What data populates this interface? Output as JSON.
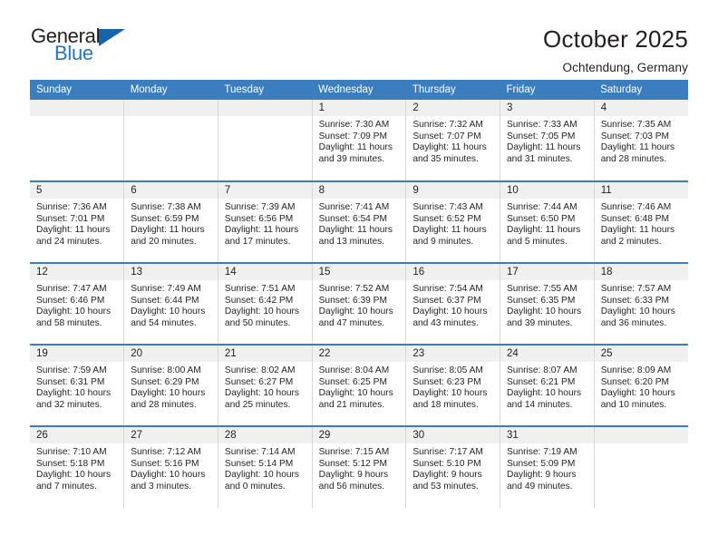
{
  "logo": {
    "text_top": "General",
    "text_bottom": "Blue",
    "triangle_color": "#1565a8",
    "blue_color": "#2077bd"
  },
  "header": {
    "title": "October 2025",
    "subtitle": "Ochtendung, Germany"
  },
  "theme": {
    "header_bar": "#3a7ebf",
    "daynum_band": "#f0f0f0",
    "text": "#231f20",
    "cell_border": "#d8d8d8"
  },
  "weekday_headers": [
    "Sunday",
    "Monday",
    "Tuesday",
    "Wednesday",
    "Thursday",
    "Friday",
    "Saturday"
  ],
  "weeks": [
    [
      {
        "day": "",
        "sunrise": "",
        "sunset": "",
        "daylight_line1": "",
        "daylight_line2": ""
      },
      {
        "day": "",
        "sunrise": "",
        "sunset": "",
        "daylight_line1": "",
        "daylight_line2": ""
      },
      {
        "day": "",
        "sunrise": "",
        "sunset": "",
        "daylight_line1": "",
        "daylight_line2": ""
      },
      {
        "day": "1",
        "sunrise": "Sunrise: 7:30 AM",
        "sunset": "Sunset: 7:09 PM",
        "daylight_line1": "Daylight: 11 hours",
        "daylight_line2": "and 39 minutes."
      },
      {
        "day": "2",
        "sunrise": "Sunrise: 7:32 AM",
        "sunset": "Sunset: 7:07 PM",
        "daylight_line1": "Daylight: 11 hours",
        "daylight_line2": "and 35 minutes."
      },
      {
        "day": "3",
        "sunrise": "Sunrise: 7:33 AM",
        "sunset": "Sunset: 7:05 PM",
        "daylight_line1": "Daylight: 11 hours",
        "daylight_line2": "and 31 minutes."
      },
      {
        "day": "4",
        "sunrise": "Sunrise: 7:35 AM",
        "sunset": "Sunset: 7:03 PM",
        "daylight_line1": "Daylight: 11 hours",
        "daylight_line2": "and 28 minutes."
      }
    ],
    [
      {
        "day": "5",
        "sunrise": "Sunrise: 7:36 AM",
        "sunset": "Sunset: 7:01 PM",
        "daylight_line1": "Daylight: 11 hours",
        "daylight_line2": "and 24 minutes."
      },
      {
        "day": "6",
        "sunrise": "Sunrise: 7:38 AM",
        "sunset": "Sunset: 6:59 PM",
        "daylight_line1": "Daylight: 11 hours",
        "daylight_line2": "and 20 minutes."
      },
      {
        "day": "7",
        "sunrise": "Sunrise: 7:39 AM",
        "sunset": "Sunset: 6:56 PM",
        "daylight_line1": "Daylight: 11 hours",
        "daylight_line2": "and 17 minutes."
      },
      {
        "day": "8",
        "sunrise": "Sunrise: 7:41 AM",
        "sunset": "Sunset: 6:54 PM",
        "daylight_line1": "Daylight: 11 hours",
        "daylight_line2": "and 13 minutes."
      },
      {
        "day": "9",
        "sunrise": "Sunrise: 7:43 AM",
        "sunset": "Sunset: 6:52 PM",
        "daylight_line1": "Daylight: 11 hours",
        "daylight_line2": "and 9 minutes."
      },
      {
        "day": "10",
        "sunrise": "Sunrise: 7:44 AM",
        "sunset": "Sunset: 6:50 PM",
        "daylight_line1": "Daylight: 11 hours",
        "daylight_line2": "and 5 minutes."
      },
      {
        "day": "11",
        "sunrise": "Sunrise: 7:46 AM",
        "sunset": "Sunset: 6:48 PM",
        "daylight_line1": "Daylight: 11 hours",
        "daylight_line2": "and 2 minutes."
      }
    ],
    [
      {
        "day": "12",
        "sunrise": "Sunrise: 7:47 AM",
        "sunset": "Sunset: 6:46 PM",
        "daylight_line1": "Daylight: 10 hours",
        "daylight_line2": "and 58 minutes."
      },
      {
        "day": "13",
        "sunrise": "Sunrise: 7:49 AM",
        "sunset": "Sunset: 6:44 PM",
        "daylight_line1": "Daylight: 10 hours",
        "daylight_line2": "and 54 minutes."
      },
      {
        "day": "14",
        "sunrise": "Sunrise: 7:51 AM",
        "sunset": "Sunset: 6:42 PM",
        "daylight_line1": "Daylight: 10 hours",
        "daylight_line2": "and 50 minutes."
      },
      {
        "day": "15",
        "sunrise": "Sunrise: 7:52 AM",
        "sunset": "Sunset: 6:39 PM",
        "daylight_line1": "Daylight: 10 hours",
        "daylight_line2": "and 47 minutes."
      },
      {
        "day": "16",
        "sunrise": "Sunrise: 7:54 AM",
        "sunset": "Sunset: 6:37 PM",
        "daylight_line1": "Daylight: 10 hours",
        "daylight_line2": "and 43 minutes."
      },
      {
        "day": "17",
        "sunrise": "Sunrise: 7:55 AM",
        "sunset": "Sunset: 6:35 PM",
        "daylight_line1": "Daylight: 10 hours",
        "daylight_line2": "and 39 minutes."
      },
      {
        "day": "18",
        "sunrise": "Sunrise: 7:57 AM",
        "sunset": "Sunset: 6:33 PM",
        "daylight_line1": "Daylight: 10 hours",
        "daylight_line2": "and 36 minutes."
      }
    ],
    [
      {
        "day": "19",
        "sunrise": "Sunrise: 7:59 AM",
        "sunset": "Sunset: 6:31 PM",
        "daylight_line1": "Daylight: 10 hours",
        "daylight_line2": "and 32 minutes."
      },
      {
        "day": "20",
        "sunrise": "Sunrise: 8:00 AM",
        "sunset": "Sunset: 6:29 PM",
        "daylight_line1": "Daylight: 10 hours",
        "daylight_line2": "and 28 minutes."
      },
      {
        "day": "21",
        "sunrise": "Sunrise: 8:02 AM",
        "sunset": "Sunset: 6:27 PM",
        "daylight_line1": "Daylight: 10 hours",
        "daylight_line2": "and 25 minutes."
      },
      {
        "day": "22",
        "sunrise": "Sunrise: 8:04 AM",
        "sunset": "Sunset: 6:25 PM",
        "daylight_line1": "Daylight: 10 hours",
        "daylight_line2": "and 21 minutes."
      },
      {
        "day": "23",
        "sunrise": "Sunrise: 8:05 AM",
        "sunset": "Sunset: 6:23 PM",
        "daylight_line1": "Daylight: 10 hours",
        "daylight_line2": "and 18 minutes."
      },
      {
        "day": "24",
        "sunrise": "Sunrise: 8:07 AM",
        "sunset": "Sunset: 6:21 PM",
        "daylight_line1": "Daylight: 10 hours",
        "daylight_line2": "and 14 minutes."
      },
      {
        "day": "25",
        "sunrise": "Sunrise: 8:09 AM",
        "sunset": "Sunset: 6:20 PM",
        "daylight_line1": "Daylight: 10 hours",
        "daylight_line2": "and 10 minutes."
      }
    ],
    [
      {
        "day": "26",
        "sunrise": "Sunrise: 7:10 AM",
        "sunset": "Sunset: 5:18 PM",
        "daylight_line1": "Daylight: 10 hours",
        "daylight_line2": "and 7 minutes."
      },
      {
        "day": "27",
        "sunrise": "Sunrise: 7:12 AM",
        "sunset": "Sunset: 5:16 PM",
        "daylight_line1": "Daylight: 10 hours",
        "daylight_line2": "and 3 minutes."
      },
      {
        "day": "28",
        "sunrise": "Sunrise: 7:14 AM",
        "sunset": "Sunset: 5:14 PM",
        "daylight_line1": "Daylight: 10 hours",
        "daylight_line2": "and 0 minutes."
      },
      {
        "day": "29",
        "sunrise": "Sunrise: 7:15 AM",
        "sunset": "Sunset: 5:12 PM",
        "daylight_line1": "Daylight: 9 hours",
        "daylight_line2": "and 56 minutes."
      },
      {
        "day": "30",
        "sunrise": "Sunrise: 7:17 AM",
        "sunset": "Sunset: 5:10 PM",
        "daylight_line1": "Daylight: 9 hours",
        "daylight_line2": "and 53 minutes."
      },
      {
        "day": "31",
        "sunrise": "Sunrise: 7:19 AM",
        "sunset": "Sunset: 5:09 PM",
        "daylight_line1": "Daylight: 9 hours",
        "daylight_line2": "and 49 minutes."
      },
      {
        "day": "",
        "sunrise": "",
        "sunset": "",
        "daylight_line1": "",
        "daylight_line2": ""
      }
    ]
  ]
}
